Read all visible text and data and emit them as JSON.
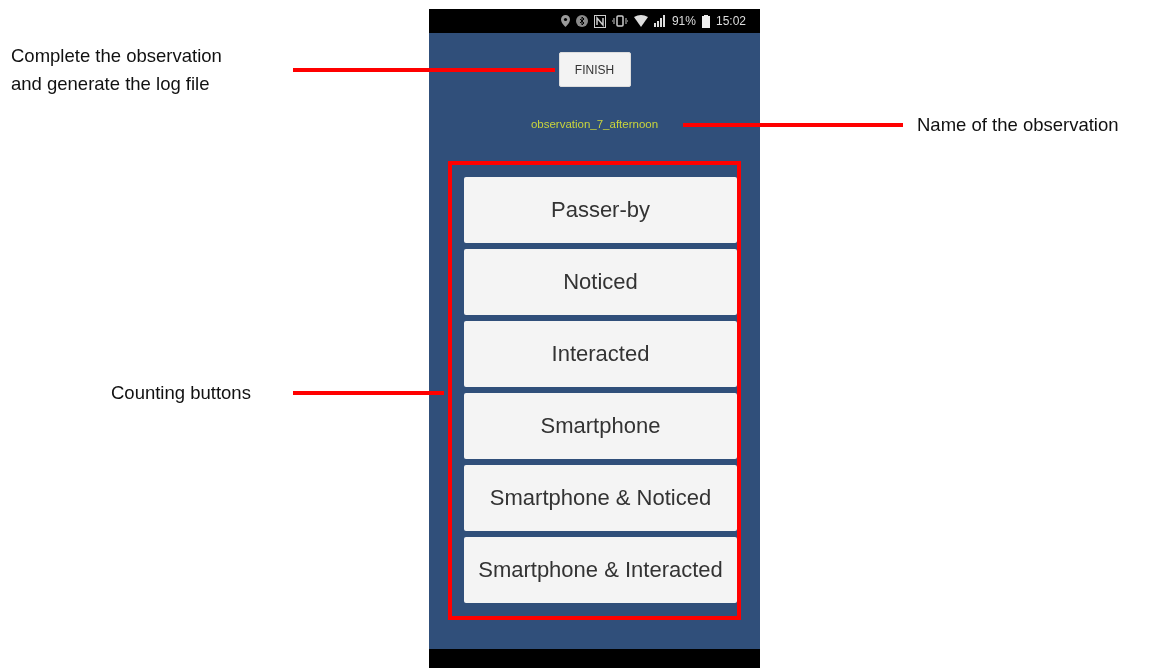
{
  "status_bar": {
    "battery": "91%",
    "time": "15:02"
  },
  "finish_button": "FINISH",
  "observation_name": "observation_7_afternoon",
  "counting_buttons": [
    "Passer-by",
    "Noticed",
    "Interacted",
    "Smartphone",
    "Smartphone & Noticed",
    "Smartphone & Interacted"
  ],
  "annotations": [
    {
      "text": "Complete the observation\nand generate the log file"
    },
    {
      "text": "Name of the observation"
    },
    {
      "text": "Counting buttons"
    }
  ]
}
